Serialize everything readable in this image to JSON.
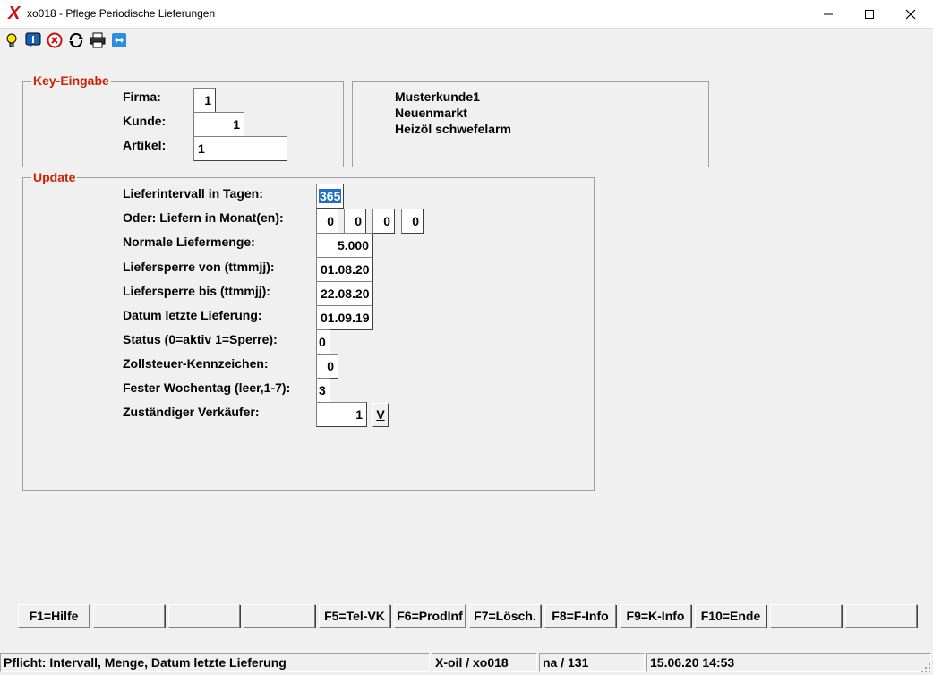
{
  "window": {
    "title": "xo018 - Pflege Periodische Lieferungen",
    "logo": "X",
    "controls": [
      "minimize-icon",
      "maximize-icon",
      "close-icon"
    ]
  },
  "toolbar": {
    "icons": [
      "lightbulb-icon",
      "info-icon",
      "cancel-icon",
      "refresh-icon",
      "printer-icon",
      "remote-support-icon"
    ]
  },
  "key_group": {
    "title": "Key-Eingabe",
    "firma_label": "Firma:",
    "firma_value": "1",
    "kunde_label": "Kunde:",
    "kunde_value": "1",
    "artikel_label": "Artikel:",
    "artikel_value": "1"
  },
  "customer_info": {
    "line1": "Musterkunde1",
    "line2": "Neuenmarkt",
    "line3": "Heizöl schwefelarm"
  },
  "update_group": {
    "title": "Update",
    "intervall_label": "Lieferintervall in Tagen:",
    "intervall_value": "365",
    "monate_label": "Oder: Liefern in Monat(en):",
    "monate_values": [
      "0",
      "0",
      "0",
      "0"
    ],
    "menge_label": "Normale Liefermenge:",
    "menge_value": "5.000",
    "sperre_von_label": "Liefersperre von (ttmmjj):",
    "sperre_von_value": "01.08.20",
    "sperre_bis_label": "Liefersperre bis (ttmmjj):",
    "sperre_bis_value": "22.08.20",
    "letzte_label": "Datum letzte Lieferung:",
    "letzte_value": "01.09.19",
    "status_label": "Status (0=aktiv 1=Sperre):",
    "status_value": "0",
    "zoll_label": "Zollsteuer-Kennzeichen:",
    "zoll_value": "0",
    "wochentag_label": "Fester Wochentag (leer,1-7):",
    "wochentag_value": "3",
    "verkaeufer_label": "Zuständiger Verkäufer:",
    "verkaeufer_value": "1",
    "verkaeufer_button": "V"
  },
  "function_keys": [
    "F1=Hilfe",
    "",
    "",
    "",
    "F5=Tel-VK",
    "F6=ProdInf",
    "F7=Lösch.",
    "F8=F-Info",
    "F9=K-Info",
    "F10=Ende",
    "",
    ""
  ],
  "statusbar": {
    "message": "Pflicht: Intervall, Menge, Datum letzte Lieferung",
    "program": "X-oil / xo018",
    "user": "na / 131",
    "datetime": "15.06.20 14:53"
  }
}
